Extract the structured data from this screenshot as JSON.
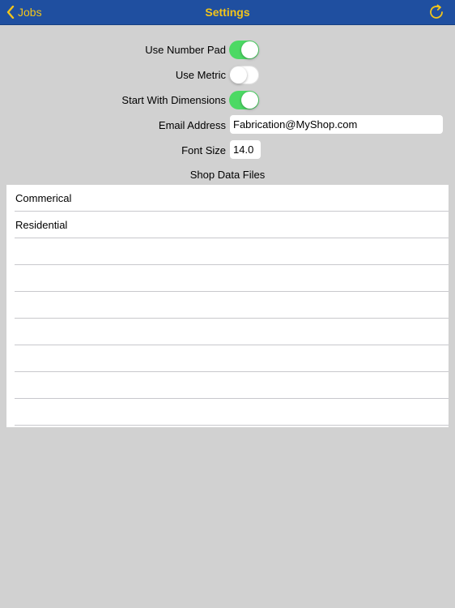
{
  "navbar": {
    "back_label": "Jobs",
    "title": "Settings",
    "back_icon": "chevron-left-icon",
    "refresh_icon": "refresh-icon",
    "accent_color": "#f3c51a",
    "bar_color": "#1f4fa0"
  },
  "settings": {
    "use_number_pad": {
      "label": "Use Number Pad",
      "on": true
    },
    "use_metric": {
      "label": "Use Metric",
      "on": false
    },
    "start_with_dimensions": {
      "label": "Start With Dimensions",
      "on": true
    },
    "email": {
      "label": "Email Address",
      "value": "Fabrication@MyShop.com"
    },
    "font_size": {
      "label": "Font Size",
      "value": "14.0"
    }
  },
  "shop_files": {
    "title": "Shop Data Files",
    "items": [
      "Commerical",
      "Residential",
      "",
      "",
      "",
      "",
      "",
      "",
      ""
    ]
  }
}
